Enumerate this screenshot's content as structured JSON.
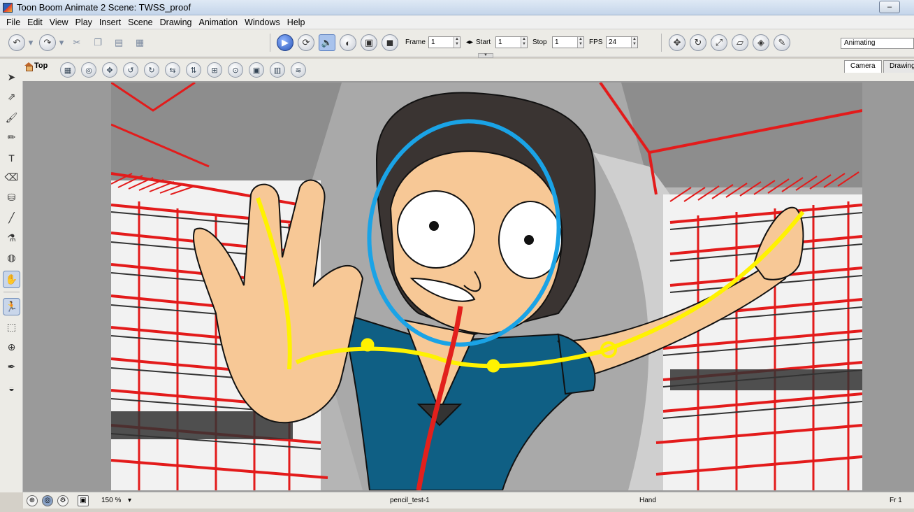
{
  "window": {
    "title": "Toon Boom Animate 2 Scene: TWSS_proof",
    "controls": [
      "–",
      "□",
      "✕"
    ]
  },
  "menu": [
    "File",
    "Edit",
    "View",
    "Play",
    "Insert",
    "Scene",
    "Drawing",
    "Animation",
    "Windows",
    "Help"
  ],
  "playback": {
    "frame_label": "Frame",
    "frame_value": "1",
    "start_label": "Start",
    "start_value": "1",
    "stop_label": "Stop",
    "stop_value": "1",
    "fps_label": "FPS",
    "fps_value": "24"
  },
  "mode_combo": {
    "value": "Animating"
  },
  "view": {
    "title": "Top",
    "tabs": [
      "Camera",
      "Drawing"
    ]
  },
  "status": {
    "zoom": "150 %",
    "layer": "pencil_test-1",
    "tool": "Hand",
    "frame": "Fr 1"
  },
  "colors": {
    "skin": "#f7c896",
    "hair": "#3a3432",
    "shirt": "#0f5f84",
    "guide_yellow": "#fff200",
    "guide_blue": "#1aa3e6",
    "guide_red": "#e2201c",
    "sketch_red": "#e31b1b"
  },
  "icons": {
    "undo": "undo-icon",
    "redo": "redo-icon",
    "play": "play-icon",
    "loop": "loop-icon",
    "sound": "sound-icon",
    "hand": "hand-icon"
  }
}
